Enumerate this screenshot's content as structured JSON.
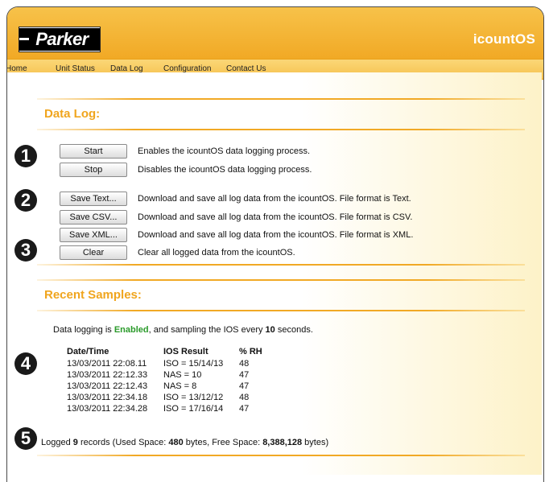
{
  "header": {
    "brand": "Parker",
    "product": "icountOS",
    "accent_color": "#f1a925"
  },
  "nav": {
    "items": [
      {
        "label": "Home"
      },
      {
        "label": "Unit Status"
      },
      {
        "label": "Data Log"
      },
      {
        "label": "Configuration"
      },
      {
        "label": "Contact Us"
      }
    ]
  },
  "data_log": {
    "title": "Data Log:",
    "actions": [
      {
        "button": "Start",
        "description": "Enables the icountOS data logging process."
      },
      {
        "button": "Stop",
        "description": "Disables the icountOS data logging process."
      },
      {
        "button": "Save Text...",
        "description": "Download and save all log data from the icountOS. File format is Text."
      },
      {
        "button": "Save CSV...",
        "description": "Download and save all log data from the icountOS. File format is CSV."
      },
      {
        "button": "Save XML...",
        "description": "Download and save all log data from the icountOS. File format is XML."
      },
      {
        "button": "Clear",
        "description": "Clear all logged data from the icountOS."
      }
    ]
  },
  "recent_samples": {
    "title": "Recent Samples:",
    "status_prefix": "Data logging is ",
    "status_value": "Enabled",
    "status_mid": ", and sampling the IOS every ",
    "interval": "10",
    "status_suffix": " seconds.",
    "columns": [
      "Date/Time",
      "IOS Result",
      "% RH"
    ],
    "rows": [
      [
        "13/03/2011 22:08.11",
        "ISO = 15/14/13",
        "48"
      ],
      [
        "13/03/2011 22:12.33",
        "NAS = 10",
        "47"
      ],
      [
        "13/03/2011 22:12.43",
        "NAS = 8",
        "47"
      ],
      [
        "13/03/2011 22:34.18",
        "ISO = 13/12/12",
        "48"
      ],
      [
        "13/03/2011 22:34.28",
        "ISO = 17/16/14",
        "47"
      ]
    ],
    "footer": {
      "logged_prefix": "Logged ",
      "records": "9",
      "records_suffix": " records (Used Space: ",
      "used": "480",
      "used_suffix": " bytes, Free Space: ",
      "free": "8,388,128",
      "free_suffix": " bytes)"
    }
  },
  "callouts": [
    "1",
    "2",
    "3",
    "4",
    "5"
  ]
}
